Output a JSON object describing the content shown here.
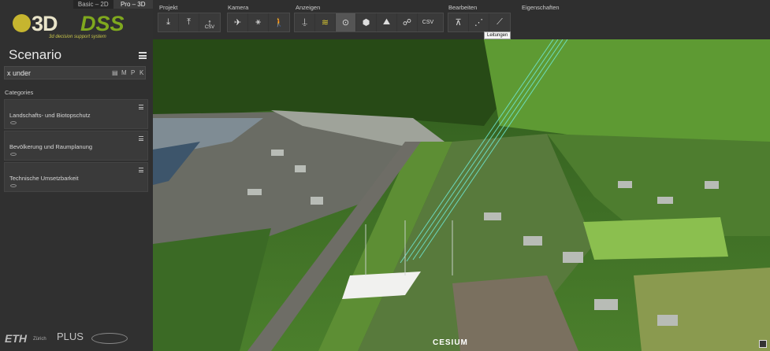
{
  "modes": {
    "basic": "Basic – 2D",
    "pro": "Pro – 3D"
  },
  "logo": {
    "name": "3D",
    "suffix": "DSS",
    "tagline": "3d decision support system"
  },
  "sidebar": {
    "title": "Scenario",
    "search_value": "x under",
    "search_icons": [
      "M",
      "P",
      "K"
    ],
    "categories_label": "Categories",
    "categories": [
      {
        "label": "Landschafts- und Biotopschutz"
      },
      {
        "label": "Bevölkerung und Raumplanung"
      },
      {
        "label": "Technische Umsetzbarkeit"
      }
    ]
  },
  "footer": {
    "eth": "ETH",
    "eth_sub": "Zürich",
    "plus": "PLUS"
  },
  "toolbar": {
    "groups": {
      "projekt": "Projekt",
      "kamera": "Kamera",
      "anzeigen": "Anzeigen",
      "bearbeiten": "Bearbeiten",
      "eigenschaften": "Eigenschaften"
    },
    "csv": "CSV",
    "tooltip": "Leitungen"
  },
  "viewer": {
    "attribution": "CESIUM"
  }
}
